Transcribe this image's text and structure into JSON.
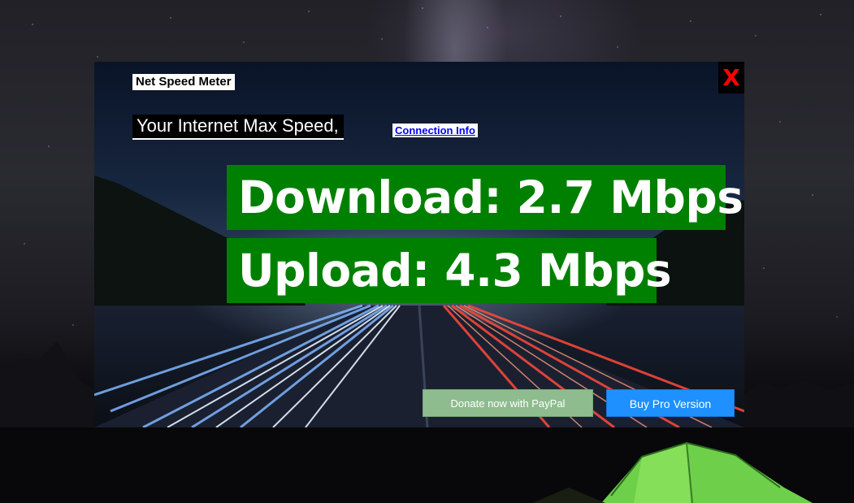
{
  "app": {
    "title": "Net Speed Meter",
    "close_label": "X",
    "max_speed_label": "Your Internet Max Speed,",
    "connection_info_link": "Connection Info"
  },
  "speed": {
    "download_text": "Download: 2.7 Mbps",
    "upload_text": "Upload: 4.3 Mbps",
    "download_mbps": 2.7,
    "upload_mbps": 4.3
  },
  "buttons": {
    "donate_label": "Donate now with PayPal",
    "pro_label": "Buy Pro Version"
  },
  "colors": {
    "speed_box": "#008000",
    "close_x": "#ff0000",
    "link": "#0000ff",
    "donate_button": "#8fbc8f",
    "pro_button": "#1e90ff"
  }
}
